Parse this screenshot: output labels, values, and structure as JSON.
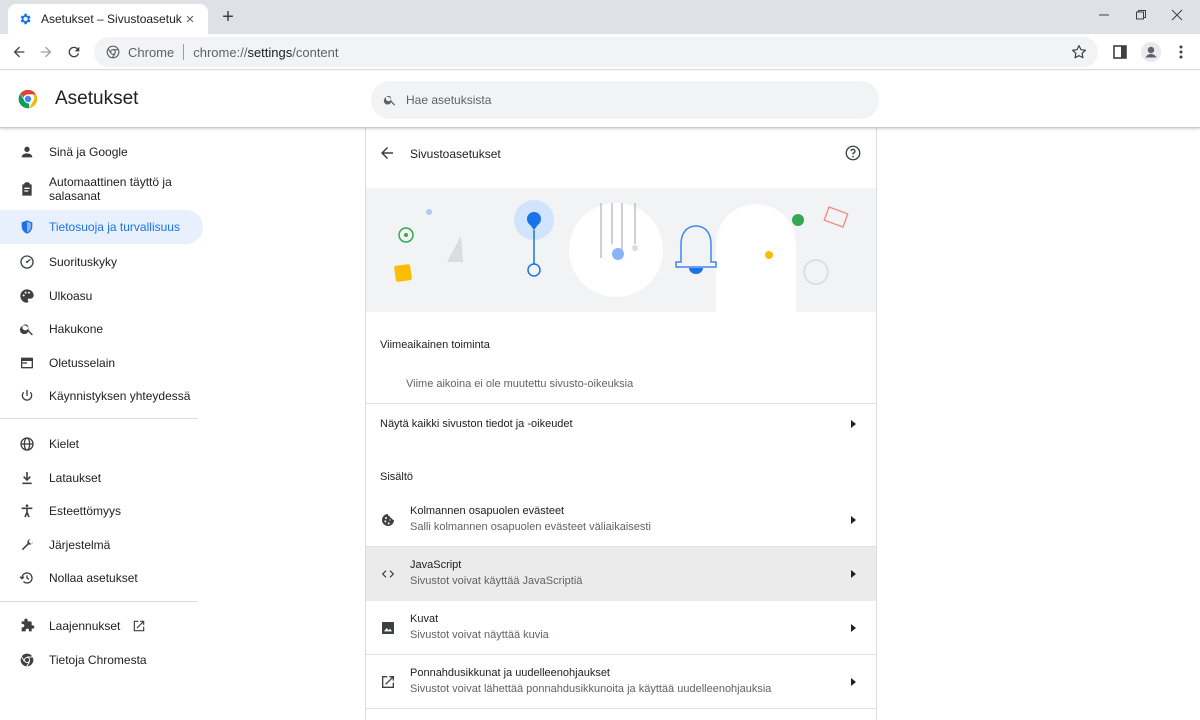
{
  "browser": {
    "tab_title": "Asetukset – Sivustoasetukset",
    "tab_close": "×",
    "new_tab": "+",
    "omnibox_chrome_label": "Chrome",
    "url_scheme": "chrome://",
    "url_host": "settings",
    "url_path": "/content"
  },
  "settings": {
    "title": "Asetukset",
    "search_placeholder": "Hae asetuksista"
  },
  "sidebar": {
    "items": [
      {
        "label": "Sinä ja Google",
        "icon": "person-icon"
      },
      {
        "label": "Automaattinen täyttö ja salasanat",
        "icon": "clipboard-icon"
      },
      {
        "label": "Tietosuoja ja turvallisuus",
        "icon": "shield-icon",
        "active": true
      },
      {
        "label": "Suorituskyky",
        "icon": "speedometer-icon"
      },
      {
        "label": "Ulkoasu",
        "icon": "palette-icon"
      },
      {
        "label": "Hakukone",
        "icon": "search-icon"
      },
      {
        "label": "Oletusselain",
        "icon": "browser-window-icon"
      },
      {
        "label": "Käynnistyksen yhteydessä",
        "icon": "power-icon"
      },
      {
        "label": "Kielet",
        "icon": "globe-icon"
      },
      {
        "label": "Lataukset",
        "icon": "download-icon"
      },
      {
        "label": "Esteettömyys",
        "icon": "accessibility-icon"
      },
      {
        "label": "Järjestelmä",
        "icon": "wrench-icon"
      },
      {
        "label": "Nollaa asetukset",
        "icon": "reset-history-icon"
      },
      {
        "label": "Laajennukset",
        "icon": "puzzle-icon"
      },
      {
        "label": "Tietoja Chromesta",
        "icon": "chrome-logo-icon"
      }
    ]
  },
  "page": {
    "title": "Sivustoasetukset",
    "recent_activity_heading": "Viimeaikainen toiminta",
    "recent_activity_empty": "Viime aikoina ei ole muutettu sivusto-oikeuksia",
    "view_all_label": "Näytä kaikki sivuston tiedot ja -oikeudet",
    "content_heading": "Sisältö",
    "permissions": [
      {
        "title": "Kolmannen osapuolen evästeet",
        "subtitle": "Salli kolmannen osapuolen evästeet väliaikaisesti",
        "icon": "cookie-icon"
      },
      {
        "title": "JavaScript",
        "subtitle": "Sivustot voivat käyttää JavaScriptiä",
        "icon": "code-icon"
      },
      {
        "title": "Kuvat",
        "subtitle": "Sivustot voivat näyttää kuvia",
        "icon": "image-icon"
      },
      {
        "title": "Ponnahdusikkunat ja uudelleenohjaukset",
        "subtitle": "Sivustot voivat lähettää ponnahdusikkunoita ja käyttää uudelleenohjauksia",
        "icon": "open-in-new-icon"
      }
    ]
  },
  "colors": {
    "accent": "#1a73e8",
    "active_nav_bg": "#e8f0fe",
    "tabstrip_bg": "#dee1e6",
    "banner_bg": "#f1f3f4",
    "hover_row_bg": "#ebebeb"
  }
}
